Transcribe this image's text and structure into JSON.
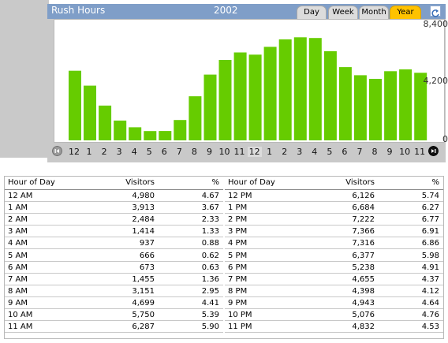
{
  "header": {
    "title": "Rush Hours",
    "year": "2002"
  },
  "tabs": [
    {
      "label": "Day",
      "active": false
    },
    {
      "label": "Week",
      "active": false
    },
    {
      "label": "Month",
      "active": false
    },
    {
      "label": "Year",
      "active": true
    }
  ],
  "colors": {
    "bar": "#66cc00",
    "header": "#7f9ec8",
    "active_tab": "#ffc200",
    "panel": "#c9c9c9"
  },
  "chart_data": {
    "type": "bar",
    "categories": [
      "12",
      "1",
      "2",
      "3",
      "4",
      "5",
      "6",
      "7",
      "8",
      "9",
      "10",
      "11",
      "12",
      "1",
      "2",
      "3",
      "4",
      "5",
      "6",
      "7",
      "8",
      "9",
      "10",
      "11"
    ],
    "values": [
      4980,
      3913,
      2484,
      1414,
      937,
      666,
      673,
      1455,
      3151,
      4699,
      5750,
      6287,
      6126,
      6684,
      7222,
      7366,
      7316,
      6377,
      5238,
      4655,
      4398,
      4943,
      5076,
      4832
    ],
    "yticks": [
      "8,400",
      "4,200",
      "0"
    ],
    "ylim": [
      0,
      8400
    ]
  },
  "table": {
    "headers": [
      "Hour of Day",
      "Visitors",
      "%"
    ],
    "left": [
      [
        "12 AM",
        "4,980",
        "4.67"
      ],
      [
        "1 AM",
        "3,913",
        "3.67"
      ],
      [
        "2 AM",
        "2,484",
        "2.33"
      ],
      [
        "3 AM",
        "1,414",
        "1.33"
      ],
      [
        "4 AM",
        "937",
        "0.88"
      ],
      [
        "5 AM",
        "666",
        "0.62"
      ],
      [
        "6 AM",
        "673",
        "0.63"
      ],
      [
        "7 AM",
        "1,455",
        "1.36"
      ],
      [
        "8 AM",
        "3,151",
        "2.95"
      ],
      [
        "9 AM",
        "4,699",
        "4.41"
      ],
      [
        "10 AM",
        "5,750",
        "5.39"
      ],
      [
        "11 AM",
        "6,287",
        "5.90"
      ]
    ],
    "right": [
      [
        "12 PM",
        "6,126",
        "5.74"
      ],
      [
        "1 PM",
        "6,684",
        "6.27"
      ],
      [
        "2 PM",
        "7,222",
        "6.77"
      ],
      [
        "3 PM",
        "7,366",
        "6.91"
      ],
      [
        "4 PM",
        "7,316",
        "6.86"
      ],
      [
        "5 PM",
        "6,377",
        "5.98"
      ],
      [
        "6 PM",
        "5,238",
        "4.91"
      ],
      [
        "7 PM",
        "4,655",
        "4.37"
      ],
      [
        "8 PM",
        "4,398",
        "4.12"
      ],
      [
        "9 PM",
        "4,943",
        "4.64"
      ],
      [
        "10 PM",
        "5,076",
        "4.76"
      ],
      [
        "11 PM",
        "4,832",
        "4.53"
      ]
    ]
  }
}
